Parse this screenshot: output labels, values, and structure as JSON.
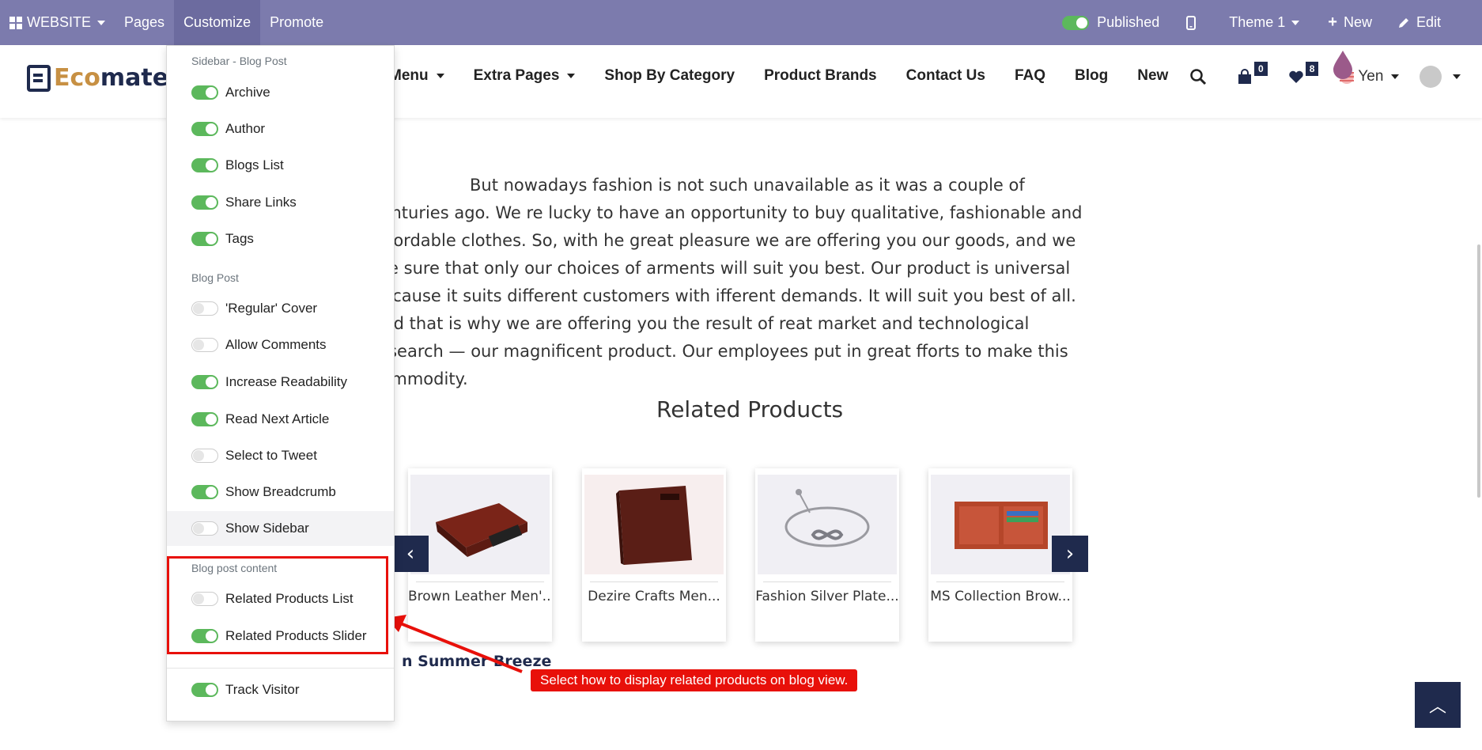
{
  "adminbar": {
    "website_label": "WEBSITE",
    "pages_label": "Pages",
    "customize_label": "Customize",
    "promote_label": "Promote",
    "published_label": "Published",
    "theme_label": "Theme 1",
    "new_label": "New",
    "edit_label": "Edit"
  },
  "header": {
    "logo_part1": "Eco",
    "logo_part2": "mate",
    "nav": [
      "Menu",
      "Extra Pages",
      "Shop By Category",
      "Product Brands",
      "Contact Us",
      "FAQ",
      "Blog",
      "New"
    ],
    "cart_count": "0",
    "wishlist_count": "8",
    "currency_label": "Yen"
  },
  "content": {
    "paragraph": "But nowadays fashion is not such unavailable as it was a couple of centuries ago. We re lucky to have an opportunity to buy qualitative, fashionable and affordable clothes. So, with he great pleasure we are offering you our goods, and we are sure that only our choices of arments will suit you best. Our product is universal because it suits different customers with ifferent demands. It will suit you best of all. And that is why we are offering you the result of reat market and technological research — our magnificent product. Our employees put in great fforts to make this commodity.",
    "related_title": "Related Products",
    "products": [
      {
        "name": "Brown Leather Men'...",
        "icon": "wallet-brown-icon"
      },
      {
        "name": "Dezire Crafts Men...",
        "icon": "wallet-dark-icon"
      },
      {
        "name": "Fashion Silver Plate...",
        "icon": "bracelet-icon"
      },
      {
        "name": "MS Collection Brow...",
        "icon": "wallet-open-icon"
      }
    ],
    "next_article": "n Summer Breeze",
    "tooltip": "Select how to display related products on blog view."
  },
  "customize_menu": {
    "sections": [
      {
        "header": "Sidebar - Blog Post",
        "items": [
          {
            "label": "Archive",
            "on": true
          },
          {
            "label": "Author",
            "on": true
          },
          {
            "label": "Blogs List",
            "on": true
          },
          {
            "label": "Share Links",
            "on": true
          },
          {
            "label": "Tags",
            "on": true
          }
        ]
      },
      {
        "header": "Blog Post",
        "items": [
          {
            "label": "'Regular' Cover",
            "on": false
          },
          {
            "label": "Allow Comments",
            "on": false
          },
          {
            "label": "Increase Readability",
            "on": true
          },
          {
            "label": "Read Next Article",
            "on": true
          },
          {
            "label": "Select to Tweet",
            "on": false
          },
          {
            "label": "Show Breadcrumb",
            "on": true
          },
          {
            "label": "Show Sidebar",
            "on": false
          }
        ]
      },
      {
        "header": "Blog post content",
        "items": [
          {
            "label": "Related Products List",
            "on": false
          },
          {
            "label": "Related Products Slider",
            "on": true
          }
        ]
      },
      {
        "header": "",
        "items": [
          {
            "label": "Track Visitor",
            "on": true
          }
        ]
      }
    ]
  },
  "colors": {
    "adminbar": "#7c7bad",
    "navy": "#1f2a4d",
    "toggle_on": "#5cb85c",
    "annotation_red": "#e8100a"
  }
}
